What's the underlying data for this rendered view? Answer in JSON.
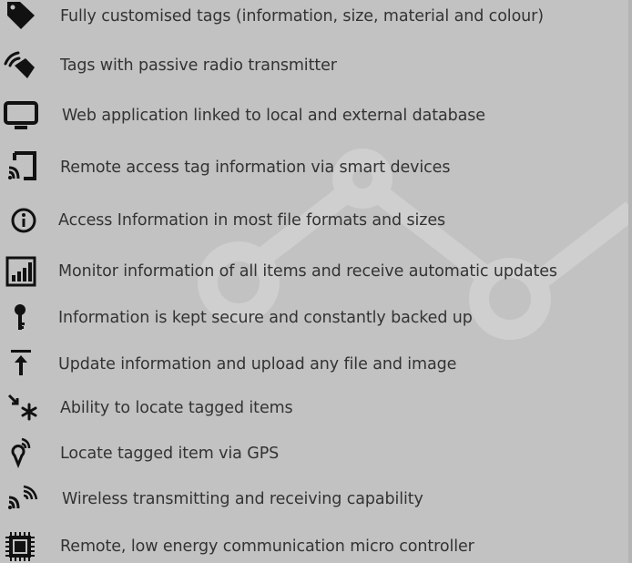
{
  "features": {
    "items": [
      {
        "icon": "tag-icon",
        "label": "Fully customised tags (information, size, material and colour)"
      },
      {
        "icon": "satellite-dish-icon",
        "label": "Tags with  passive radio transmitter"
      },
      {
        "icon": "monitor-icon",
        "label": "Web application linked to local and external database"
      },
      {
        "icon": "cast-device-icon",
        "label": "Remote access tag information via smart devices"
      },
      {
        "icon": "info-circle-icon",
        "label": "Access Information in most file formats and sizes"
      },
      {
        "icon": "bar-chart-icon",
        "label": "Monitor information of all items and receive automatic updates"
      },
      {
        "icon": "key-icon",
        "label": "Information is kept secure and constantly backed up"
      },
      {
        "icon": "upload-icon",
        "label": "Update information and upload any file and image"
      },
      {
        "icon": "locate-asterisk-icon",
        "label": "Ability to locate tagged items"
      },
      {
        "icon": "gps-pin-icon",
        "label": "Locate tagged item via GPS"
      },
      {
        "icon": "wireless-signal-icon",
        "label": "Wireless transmitting and receiving capability"
      },
      {
        "icon": "microchip-icon",
        "label": "Remote, low energy communication micro controller"
      }
    ]
  },
  "colors": {
    "background": "#c2c2c2",
    "text": "#333333",
    "icon": "#111111",
    "watermark": "#d0d0d0"
  }
}
